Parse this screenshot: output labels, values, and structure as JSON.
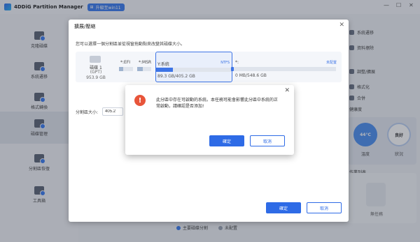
{
  "app": {
    "title": "4DDiG Partition Manager",
    "upgrade_label": "升級至win11",
    "window_controls": [
      "—",
      "☐",
      "✕"
    ]
  },
  "sidebar": {
    "items": [
      {
        "label": "克隆磁碟",
        "icon": "clone-disk-icon"
      },
      {
        "label": "系統遷移",
        "icon": "system-migration-icon"
      },
      {
        "label": "格式轉換",
        "icon": "format-convert-icon"
      },
      {
        "label": "磁碟管理",
        "icon": "disk-management-icon",
        "active": true
      },
      {
        "label": "分割區恢復",
        "icon": "partition-recovery-icon"
      },
      {
        "label": "工具箱",
        "icon": "toolbox-icon"
      }
    ]
  },
  "right_panel": {
    "items": [
      "系統遷移",
      "資料擦除",
      "調整/擴展",
      "格式化",
      "合併"
    ],
    "health_title": "健康度",
    "temperature": {
      "value": "44°C",
      "label": "溫度"
    },
    "status": {
      "value": "良好",
      "label": "狀況"
    },
    "ops_title": "作業列表",
    "ops_empty": "無任務"
  },
  "legend": {
    "primary": "主要磁碟分割",
    "unallocated": "未配置"
  },
  "dialog": {
    "title": "擴展/壓縮",
    "description": "您可以選擇一個分割區並從視窗拖動點來改變其磁碟大小。",
    "disk": {
      "name": "磁碟 1",
      "type": "(GPT)",
      "size": "953.9 GB"
    },
    "partitions": [
      {
        "label": "*:EFI"
      },
      {
        "label": "*:MSR"
      },
      {
        "label": "Y:系統",
        "fs": "NTFS",
        "capacity": "89.3 GB/405.2 GB"
      },
      {
        "label": "*:",
        "tag": "未配置",
        "capacity": "0 MB/548.6 GB"
      }
    ],
    "size_label": "分割區大小:",
    "size_value": "405.2",
    "ok_label": "確定",
    "cancel_label": "取消"
  },
  "alert": {
    "message": "此分區中存在可啟動的系統。本任務可能會影響此分區中系統的正常啟動，請確認是否添加!",
    "ok_label": "確定",
    "cancel_label": "取消"
  },
  "colors": {
    "accent": "#2e6be6",
    "warning": "#e8553a"
  }
}
